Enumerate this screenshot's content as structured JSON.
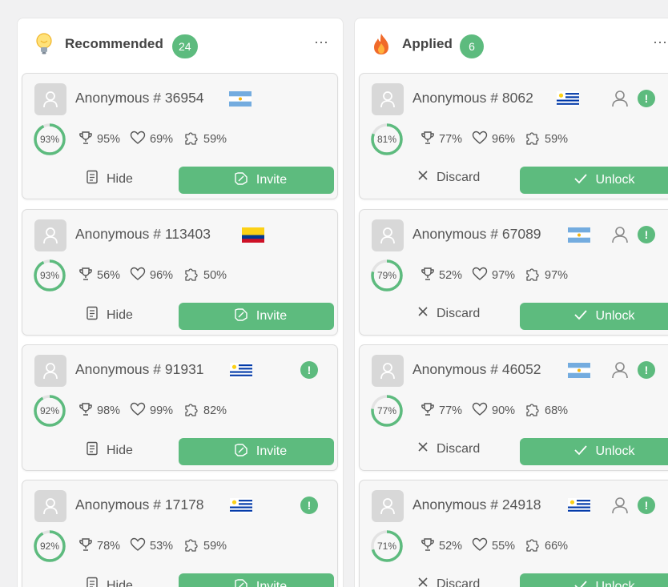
{
  "columns": [
    {
      "title": "Recommended",
      "count": "24",
      "icon": "lightbulb-icon",
      "more": "⋯",
      "left_action_label": "Hide",
      "right_action_label": "Invite",
      "cards": [
        {
          "name": "Anonymous # 36954",
          "flag": "argentina",
          "score": "93%",
          "score_value": 0.93,
          "trophy": "95%",
          "heart": "69%",
          "puzzle": "59%",
          "user_icon": false,
          "alert": false
        },
        {
          "name": "Anonymous # 113403",
          "flag": "colombia",
          "score": "93%",
          "score_value": 0.93,
          "trophy": "56%",
          "heart": "96%",
          "puzzle": "50%",
          "user_icon": false,
          "alert": false
        },
        {
          "name": "Anonymous # 91931",
          "flag": "uruguay",
          "score": "92%",
          "score_value": 0.92,
          "trophy": "98%",
          "heart": "99%",
          "puzzle": "82%",
          "user_icon": false,
          "alert": true
        },
        {
          "name": "Anonymous # 17178",
          "flag": "uruguay",
          "score": "92%",
          "score_value": 0.92,
          "trophy": "78%",
          "heart": "53%",
          "puzzle": "59%",
          "user_icon": false,
          "alert": true
        }
      ]
    },
    {
      "title": "Applied",
      "count": "6",
      "icon": "fire-icon",
      "more": "⋯",
      "left_action_label": "Discard",
      "right_action_label": "Unlock",
      "cards": [
        {
          "name": "Anonymous # 8062",
          "flag": "uruguay",
          "score": "81%",
          "score_value": 0.81,
          "trophy": "77%",
          "heart": "96%",
          "puzzle": "59%",
          "user_icon": true,
          "alert": true
        },
        {
          "name": "Anonymous # 67089",
          "flag": "argentina",
          "score": "79%",
          "score_value": 0.79,
          "trophy": "52%",
          "heart": "97%",
          "puzzle": "97%",
          "user_icon": true,
          "alert": true
        },
        {
          "name": "Anonymous # 46052",
          "flag": "argentina",
          "score": "77%",
          "score_value": 0.77,
          "trophy": "77%",
          "heart": "90%",
          "puzzle": "68%",
          "user_icon": true,
          "alert": true
        },
        {
          "name": "Anonymous # 24918",
          "flag": "uruguay",
          "score": "71%",
          "score_value": 0.71,
          "trophy": "52%",
          "heart": "55%",
          "puzzle": "66%",
          "user_icon": true,
          "alert": true
        }
      ]
    }
  ],
  "alert_glyph": "!",
  "colors": {
    "accent": "#5dbb7e",
    "ring_track": "#e3e3e3"
  }
}
